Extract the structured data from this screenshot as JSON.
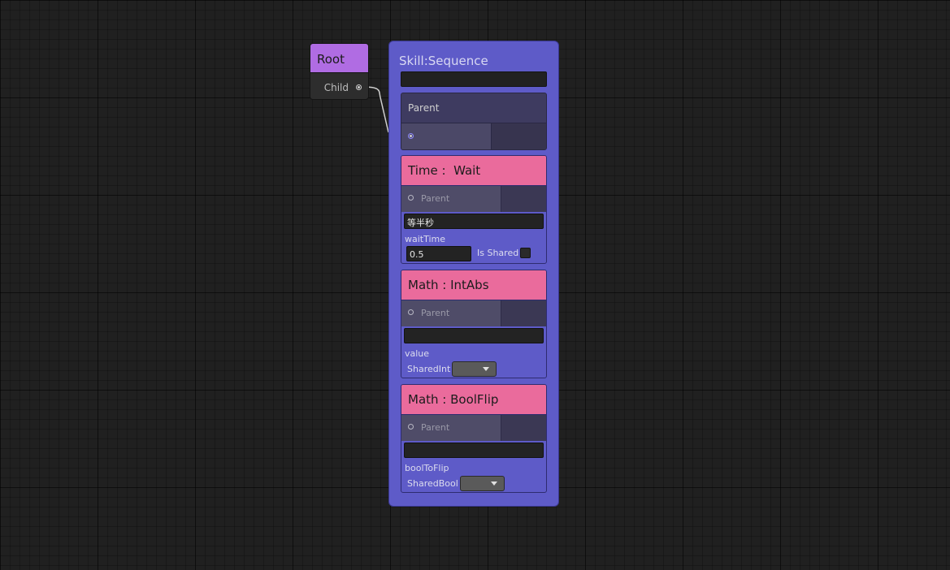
{
  "root_node": {
    "title": "Root",
    "port_label": "Child",
    "color": "#b06ce3"
  },
  "sequence_node": {
    "title": "Skill:Sequence",
    "name_value": "",
    "parent_label": "Parent",
    "color": "#5e5bc8"
  },
  "tasks": [
    {
      "title": "Time :  Wait",
      "parent_label": "Parent",
      "comment": "等半秒",
      "field_label": "waitTime",
      "field_value": "0.5",
      "shared_label": "Is Shared"
    },
    {
      "title": "Math : IntAbs",
      "parent_label": "Parent",
      "comment": "",
      "field_label": "value",
      "dropdown_label": "SharedInt",
      "dropdown_value": ""
    },
    {
      "title": "Math : BoolFlip",
      "parent_label": "Parent",
      "comment": "",
      "field_label": "boolToFlip",
      "dropdown_label": "SharedBool",
      "dropdown_value": ""
    }
  ],
  "task_color": "#ea6b9c",
  "icons": [
    "port-output-icon",
    "port-input-icon",
    "checkbox-icon",
    "dropdown-caret-icon"
  ]
}
